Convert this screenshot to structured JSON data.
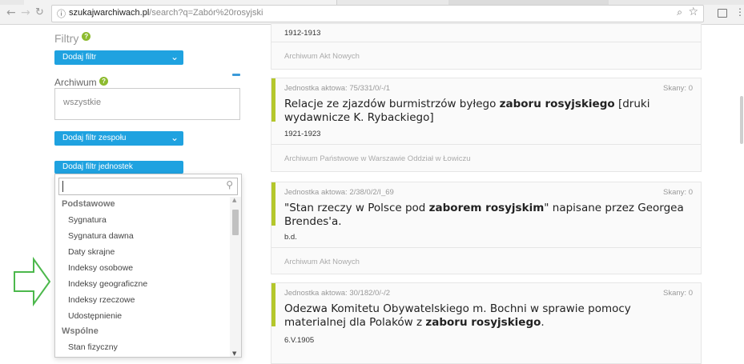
{
  "browser": {
    "url_host": "szukajwarchiwach.pl",
    "url_path": "/search?q=Zabór%20rosyjski"
  },
  "sidebar": {
    "filters_title": "Filtry",
    "add_filter_label": "Dodaj filtr",
    "archive_label": "Archiwum",
    "archive_value": "wszystkie",
    "add_fonds_filter_label": "Dodaj filtr zespołu",
    "add_unit_filter_label": "Dodaj filtr jednostek"
  },
  "dropdown": {
    "search_value": "",
    "groups": [
      {
        "label": "Podstawowe",
        "items": [
          "Sygnatura",
          "Sygnatura dawna",
          "Daty skrajne",
          "Indeksy osobowe",
          "Indeksy geograficzne",
          "Indeksy rzeczowe",
          "Udostępnienie"
        ]
      },
      {
        "label": "Wspólne",
        "items": [
          "Stan fizyczny"
        ]
      }
    ]
  },
  "results": [
    {
      "unit": "",
      "skany": "",
      "title_before": "",
      "title_bold": "",
      "title_after": "",
      "date": "1912-1913",
      "source": "Archiwum Akt Nowych"
    },
    {
      "unit": "Jednostka aktowa: 75/331/0/-/1",
      "skany": "Skany: 0",
      "title_before": "Relacje ze zjazdów burmistrzów byłego ",
      "title_bold": "zaboru rosyjskiego",
      "title_after": " [druki wydawnicze K. Rybackiego]",
      "date": "1921-1923",
      "source": "Archiwum Państwowe w Warszawie Oddział w Łowiczu"
    },
    {
      "unit": "Jednostka aktowa: 2/38/0/2/I_69",
      "skany": "Skany: 0",
      "title_before": "\"Stan rzeczy w Polsce pod ",
      "title_bold": "zaborem rosyjskim",
      "title_after": "\" napisane przez Georgea Brendes'a.",
      "date": "b.d.",
      "source": "Archiwum Akt Nowych"
    },
    {
      "unit": "Jednostka aktowa: 30/182/0/-/2",
      "skany": "Skany: 0",
      "title_before": "Odezwa Komitetu Obywatelskiego m. Bochni w sprawie pomocy materialnej dla Polaków z ",
      "title_bold": "zaboru rosyjskiego",
      "title_after": ".",
      "date": "6.V.1905",
      "source": ""
    }
  ],
  "colors": {
    "accent_blue": "#1fa2e0",
    "result_bar_green": "#b4c72b",
    "annotation_arrow_green": "#4cb84c"
  }
}
